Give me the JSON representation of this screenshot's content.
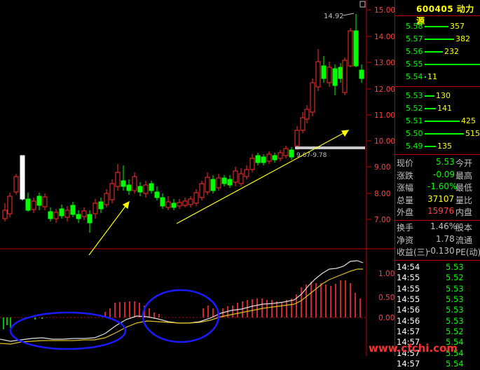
{
  "stock": {
    "code": "600405",
    "name": "动力源"
  },
  "price_axis": [
    "15.00",
    "14.00",
    "13.00",
    "12.00",
    "11.00",
    "10.00",
    "9.00",
    "8.00",
    "7.00"
  ],
  "indicator_axis": [
    "1.00",
    "0.50",
    "0.00"
  ],
  "chart_annotations": {
    "high_label": "14.92",
    "range_label": "9.67-9.78"
  },
  "order_book": {
    "asks": [
      {
        "price": "5.58",
        "vol": "357"
      },
      {
        "price": "5.57",
        "vol": "382"
      },
      {
        "price": "5.56",
        "vol": "232"
      },
      {
        "price": "5.55",
        "vol": ""
      },
      {
        "price": "5.54",
        "vol": "11"
      }
    ],
    "bids": [
      {
        "price": "5.53",
        "vol": "130"
      },
      {
        "price": "5.52",
        "vol": "141"
      },
      {
        "price": "5.51",
        "vol": "425"
      },
      {
        "price": "5.50",
        "vol": "515"
      },
      {
        "price": "5.49",
        "vol": "135"
      }
    ]
  },
  "quote": {
    "r1": {
      "l1": "现价",
      "v1": "5.53",
      "l2": "今开"
    },
    "r2": {
      "l1": "涨跌",
      "v1": "-0.09",
      "l2": "最高"
    },
    "r3": {
      "l1": "涨幅",
      "v1": "-1.60%",
      "l2": "最低"
    },
    "r4": {
      "l1": "总量",
      "v1": "37107",
      "l2": "量比"
    },
    "r5": {
      "l1": "外盘",
      "v1": "15976",
      "l2": "内盘"
    },
    "r6": {
      "l1": "换手",
      "v1": "1.46%",
      "l2": "股本"
    },
    "r7": {
      "l1": "净资",
      "v1": "1.78",
      "l2": "流通"
    },
    "r8": {
      "l1": "收益(三)",
      "v1": "-0.130",
      "l2": "PE(动)"
    }
  },
  "ticks": [
    {
      "time": "14:54",
      "price": "5.53"
    },
    {
      "time": "14:55",
      "price": "5.52"
    },
    {
      "time": "14:55",
      "price": "5.53"
    },
    {
      "time": "14:55",
      "price": "5.53"
    },
    {
      "time": "14:56",
      "price": "5.53"
    },
    {
      "time": "14:56",
      "price": "5.53"
    },
    {
      "time": "14:57",
      "price": "5.52"
    },
    {
      "time": "14:57",
      "price": "5.54"
    },
    {
      "time": "14:57",
      "price": "5.54"
    },
    {
      "time": "14:57",
      "price": "5.54"
    }
  ],
  "watermark": "www.cfchi.com",
  "colors": {
    "up": "#ff3030",
    "down": "#00ff00",
    "axis": "#c00000",
    "arrow": "#ffff00",
    "circle": "#1a1aff"
  }
}
